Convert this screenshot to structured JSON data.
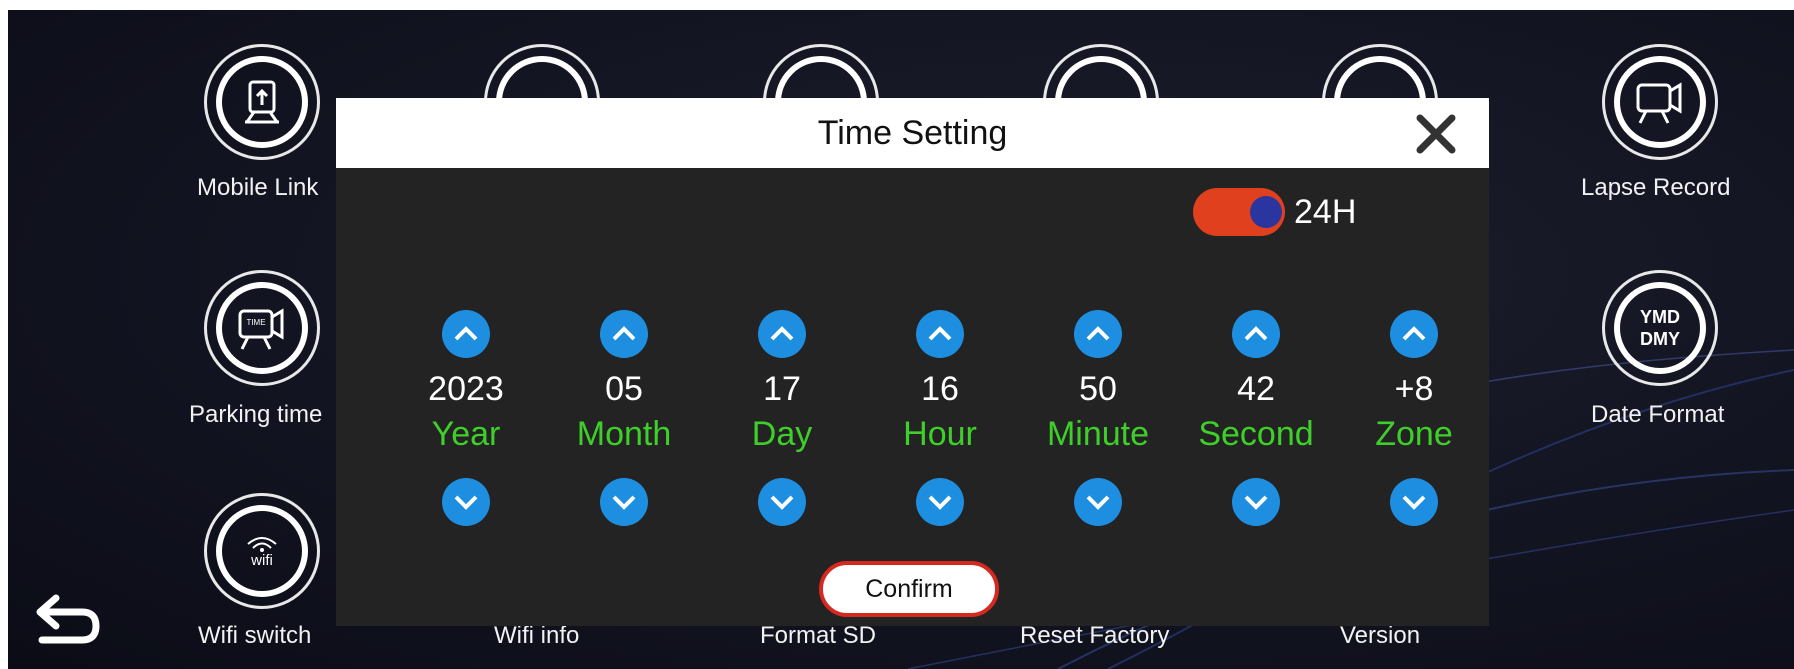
{
  "menu": {
    "items": [
      {
        "label": "Mobile Link",
        "icon": "mobile-link-icon"
      },
      {
        "label": "Parking time",
        "icon": "parking-time-icon"
      },
      {
        "label": "Wifi switch",
        "icon": "wifi-icon",
        "icon_text": "wifi"
      },
      {
        "label": "Lapse Record",
        "icon": "lapse-record-icon"
      },
      {
        "label": "Date Format",
        "icon": "date-format-icon",
        "icon_text_1": "YMD",
        "icon_text_2": "DMY"
      }
    ],
    "bottom_labels": [
      "Wifi info",
      "Format SD",
      "Reset Factory",
      "Version"
    ]
  },
  "dialog": {
    "title": "Time Setting",
    "close_icon": "close-icon",
    "toggle": {
      "label": "24H",
      "on": true,
      "color": "#e0401e"
    },
    "fields": [
      {
        "value": "2023",
        "unit": "Year"
      },
      {
        "value": "05",
        "unit": "Month"
      },
      {
        "value": "17",
        "unit": "Day"
      },
      {
        "value": "16",
        "unit": "Hour"
      },
      {
        "value": "50",
        "unit": "Minute"
      },
      {
        "value": "42",
        "unit": "Second"
      },
      {
        "value": "+8",
        "unit": "Zone"
      }
    ],
    "confirm_label": "Confirm"
  },
  "colors": {
    "accent_blue": "#1e8fe0",
    "unit_green": "#3fcf2a",
    "confirm_border": "#d62820"
  }
}
